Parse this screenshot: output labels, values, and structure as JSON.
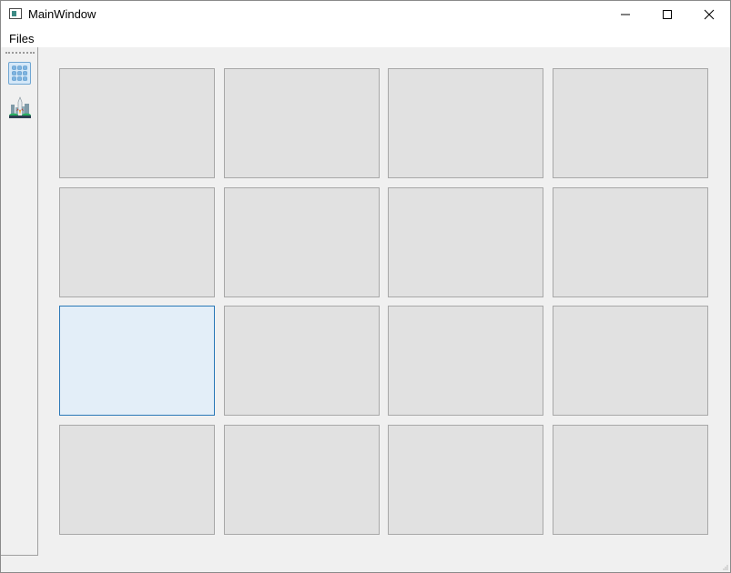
{
  "window": {
    "title": "MainWindow"
  },
  "menubar": {
    "items": [
      "Files"
    ]
  },
  "toolbar": {
    "tools": [
      "grid-view-icon",
      "city-launch-icon"
    ]
  },
  "grid": {
    "rows": 4,
    "cols": 4,
    "selected_index": 8,
    "tile_color": "#e1e1e1",
    "selected_tile_color": "#e3eef8",
    "selected_border_color": "#2a78b7"
  }
}
